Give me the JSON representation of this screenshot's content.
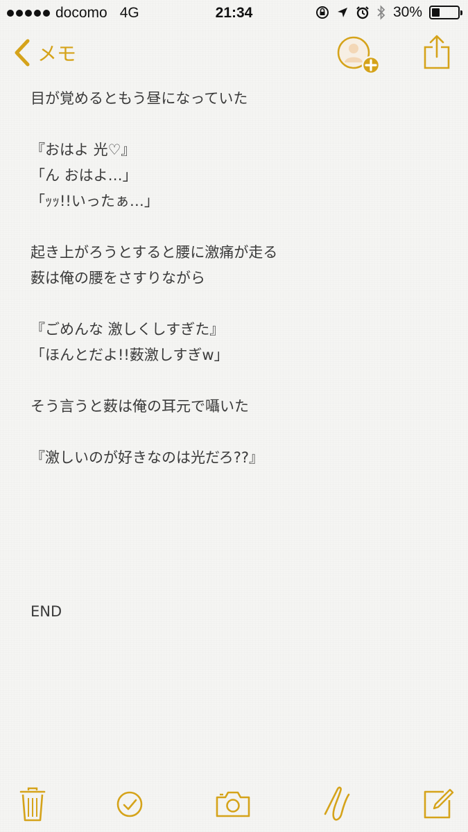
{
  "status_bar": {
    "carrier": "docomo",
    "network": "4G",
    "time": "21:34",
    "battery_percent": "30%",
    "battery_level": 0.3
  },
  "nav": {
    "back_label": "メモ",
    "add_person_icon": "person-add-icon",
    "share_icon": "share-icon"
  },
  "note": {
    "lines": [
      "目が覚めるともう昼になっていた",
      "",
      "『おはよ 光♡』",
      "「ん おはよ…」",
      "「ｯｯ!!いったぁ…」",
      "",
      "起き上がろうとすると腰に激痛が走る",
      "薮は俺の腰をさすりながら",
      "",
      "『ごめんな 激しくしすぎた』",
      "「ほんとだよ!!薮激しすぎw」",
      "",
      "そう言うと薮は俺の耳元で囁いた",
      "",
      "『激しいのが好きなのは光だろ??』",
      "",
      "",
      "",
      "",
      "",
      "END"
    ]
  },
  "toolbar": {
    "icons": [
      "trash-icon",
      "checklist-icon",
      "camera-icon",
      "sketch-icon",
      "compose-icon"
    ]
  },
  "colors": {
    "accent": "#d5a31a",
    "text": "#3a3a3a",
    "background": "#f5f5f3"
  }
}
